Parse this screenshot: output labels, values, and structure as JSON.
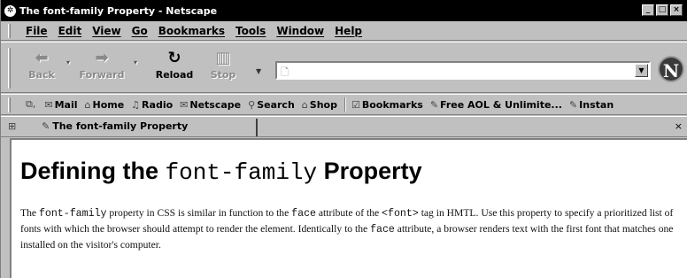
{
  "window": {
    "title": "The font-family Property - Netscape"
  },
  "window_buttons": [
    "_",
    "□",
    "×"
  ],
  "menu": [
    "File",
    "Edit",
    "View",
    "Go",
    "Bookmarks",
    "Tools",
    "Window",
    "Help"
  ],
  "nav": {
    "back": "Back",
    "forward": "Forward",
    "reload": "Reload",
    "stop": "Stop",
    "url_value": "",
    "logo_letter": "N"
  },
  "personal_toolbar": [
    "Mail",
    "Home",
    "Radio",
    "Netscape",
    "Search",
    "Shop",
    "Bookmarks",
    "Free AOL & Unlimite...",
    "Instan"
  ],
  "tab": {
    "title": "The font-family Property",
    "close": "×"
  },
  "page": {
    "heading_pre": "Defining the ",
    "heading_code": "font-family",
    "heading_post": " Property",
    "p1": "The ",
    "p_code1": "font-family",
    "p2": " property in CSS is similar in function to the ",
    "p_code2": "face",
    "p3": " attribute of the ",
    "p_code3": "<font>",
    "p4": " tag in HMTL. Use this property to specify a prioritized list of fonts with which the browser should attempt to render the element. Identically to the ",
    "p_code4": "face",
    "p5": " attribute, a browser renders text with the first font that matches one installed on the visitor's computer."
  }
}
